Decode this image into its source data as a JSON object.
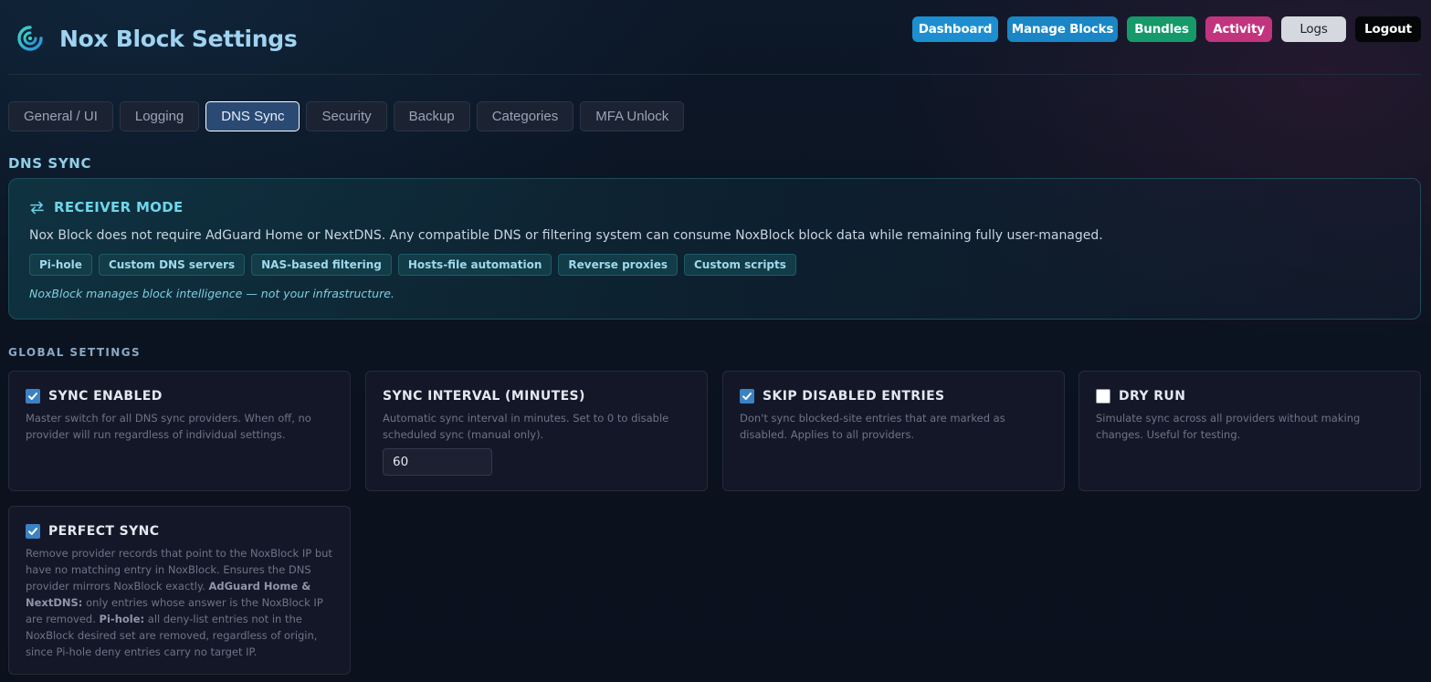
{
  "header": {
    "title": "Nox Block Settings",
    "nav": [
      {
        "label": "Dashboard",
        "color": "#1d8fd0"
      },
      {
        "label": "Manage Blocks",
        "color": "#1a86c6"
      },
      {
        "label": "Bundles",
        "color": "#169a6a"
      },
      {
        "label": "Activity",
        "color": "#c2357e"
      },
      {
        "label": "Logs",
        "color": "#d5d8de"
      },
      {
        "label": "Logout",
        "color": "#050608"
      }
    ]
  },
  "tabs": [
    {
      "label": "General / UI",
      "active": false
    },
    {
      "label": "Logging",
      "active": false
    },
    {
      "label": "DNS Sync",
      "active": true
    },
    {
      "label": "Security",
      "active": false
    },
    {
      "label": "Backup",
      "active": false
    },
    {
      "label": "Categories",
      "active": false
    },
    {
      "label": "MFA Unlock",
      "active": false
    }
  ],
  "section_title": "DNS SYNC",
  "receiver": {
    "icon": "swap-arrows-icon",
    "title": "RECEIVER MODE",
    "description": "Nox Block does not require AdGuard Home or NextDNS. Any compatible DNS or filtering system can consume NoxBlock block data while remaining fully user-managed.",
    "chips": [
      "Pi-hole",
      "Custom DNS servers",
      "NAS-based filtering",
      "Hosts-file automation",
      "Reverse proxies",
      "Custom scripts"
    ],
    "note": "NoxBlock manages block intelligence — not your infrastructure."
  },
  "global_title": "GLOBAL SETTINGS",
  "settings": {
    "sync_enabled": {
      "title": "SYNC ENABLED",
      "checked": true,
      "description": "Master switch for all DNS sync providers. When off, no provider will run regardless of individual settings."
    },
    "sync_interval": {
      "title": "SYNC INTERVAL (MINUTES)",
      "description": "Automatic sync interval in minutes. Set to 0 to disable scheduled sync (manual only).",
      "value": "60"
    },
    "skip_disabled": {
      "title": "SKIP DISABLED ENTRIES",
      "checked": true,
      "description": "Don't sync blocked-site entries that are marked as disabled. Applies to all providers."
    },
    "dry_run": {
      "title": "DRY RUN",
      "checked": false,
      "description": "Simulate sync across all providers without making changes. Useful for testing."
    },
    "perfect_sync": {
      "title": "PERFECT SYNC",
      "checked": true,
      "desc_1": "Remove provider records that point to the NoxBlock IP but have no matching entry in NoxBlock. Ensures the DNS provider mirrors NoxBlock exactly.",
      "desc_2_bold": "AdGuard Home & NextDNS:",
      "desc_3": "only entries whose answer is the NoxBlock IP are removed.",
      "desc_4_bold": "Pi-hole:",
      "desc_5": "all deny-list entries not in the NoxBlock desired set are removed, regardless of origin, since Pi-hole deny entries carry no target IP."
    }
  },
  "colors": {
    "accent": "#6fd6ea",
    "active_tab": "#2a4a74",
    "checkbox_on": "#3b82c4"
  }
}
